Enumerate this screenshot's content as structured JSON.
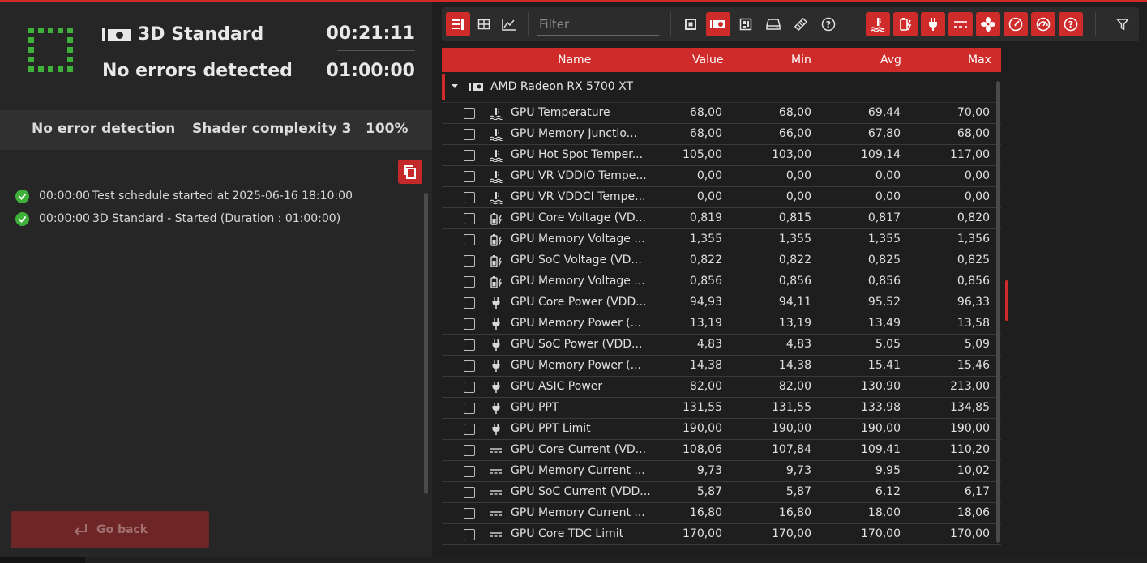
{
  "status": {
    "test_name": "3D Standard",
    "result": "No errors detected",
    "elapsed": "00:21:11",
    "duration": "01:00:00"
  },
  "params": {
    "error_detection": "No error detection",
    "shader": "Shader complexity 3",
    "load": "100%"
  },
  "log": [
    {
      "time": "00:00:00",
      "text": "Test schedule started at 2025-06-16 18:10:00"
    },
    {
      "time": "00:00:00",
      "text": "3D Standard - Started (Duration : 01:00:00)"
    }
  ],
  "go_back_label": "Go back",
  "toolbar": {
    "filter_placeholder": "Filter"
  },
  "columns": {
    "name": "Name",
    "value": "Value",
    "min": "Min",
    "avg": "Avg",
    "max": "Max"
  },
  "device": "AMD Radeon RX 5700 XT",
  "sensors": [
    {
      "icon": "temperature",
      "name": "GPU Temperature",
      "value": "68,00",
      "min": "68,00",
      "avg": "69,44",
      "max": "70,00"
    },
    {
      "icon": "temperature",
      "name": "GPU Memory Junctio...",
      "value": "68,00",
      "min": "66,00",
      "avg": "67,80",
      "max": "68,00"
    },
    {
      "icon": "temperature",
      "name": "GPU Hot Spot Temper...",
      "value": "105,00",
      "min": "103,00",
      "avg": "109,14",
      "max": "117,00"
    },
    {
      "icon": "temperature",
      "name": "GPU VR VDDIO Tempe...",
      "value": "0,00",
      "min": "0,00",
      "avg": "0,00",
      "max": "0,00"
    },
    {
      "icon": "temperature",
      "name": "GPU VR VDDCI Tempe...",
      "value": "0,00",
      "min": "0,00",
      "avg": "0,00",
      "max": "0,00"
    },
    {
      "icon": "voltage",
      "name": "GPU Core Voltage (VD...",
      "value": "0,819",
      "min": "0,815",
      "avg": "0,817",
      "max": "0,820"
    },
    {
      "icon": "voltage",
      "name": "GPU Memory Voltage ...",
      "value": "1,355",
      "min": "1,355",
      "avg": "1,355",
      "max": "1,356"
    },
    {
      "icon": "voltage",
      "name": "GPU SoC Voltage (VD...",
      "value": "0,822",
      "min": "0,822",
      "avg": "0,825",
      "max": "0,825"
    },
    {
      "icon": "voltage",
      "name": "GPU Memory Voltage ...",
      "value": "0,856",
      "min": "0,856",
      "avg": "0,856",
      "max": "0,856"
    },
    {
      "icon": "power",
      "name": "GPU Core Power (VDD...",
      "value": "94,93",
      "min": "94,11",
      "avg": "95,52",
      "max": "96,33"
    },
    {
      "icon": "power",
      "name": "GPU Memory Power (...",
      "value": "13,19",
      "min": "13,19",
      "avg": "13,49",
      "max": "13,58"
    },
    {
      "icon": "power",
      "name": "GPU SoC Power (VDD...",
      "value": "4,83",
      "min": "4,83",
      "avg": "5,05",
      "max": "5,09"
    },
    {
      "icon": "power",
      "name": "GPU Memory Power (...",
      "value": "14,38",
      "min": "14,38",
      "avg": "15,41",
      "max": "15,46"
    },
    {
      "icon": "power",
      "name": "GPU ASIC Power",
      "value": "82,00",
      "min": "82,00",
      "avg": "130,90",
      "max": "213,00"
    },
    {
      "icon": "power",
      "name": "GPU PPT",
      "value": "131,55",
      "min": "131,55",
      "avg": "133,98",
      "max": "134,85"
    },
    {
      "icon": "power",
      "name": "GPU PPT Limit",
      "value": "190,00",
      "min": "190,00",
      "avg": "190,00",
      "max": "190,00"
    },
    {
      "icon": "current",
      "name": "GPU Core Current (VD...",
      "value": "108,06",
      "min": "107,84",
      "avg": "109,41",
      "max": "110,20"
    },
    {
      "icon": "current",
      "name": "GPU Memory Current ...",
      "value": "9,73",
      "min": "9,73",
      "avg": "9,95",
      "max": "10,02"
    },
    {
      "icon": "current",
      "name": "GPU SoC Current (VDD...",
      "value": "5,87",
      "min": "5,87",
      "avg": "6,12",
      "max": "6,17"
    },
    {
      "icon": "current",
      "name": "GPU Memory Current ...",
      "value": "16,80",
      "min": "16,80",
      "avg": "18,00",
      "max": "18,06"
    },
    {
      "icon": "current",
      "name": "GPU Core TDC Limit",
      "value": "170,00",
      "min": "170,00",
      "avg": "170,00",
      "max": "170,00"
    }
  ],
  "colors": {
    "accent": "#d02b2b",
    "ok": "#3fb03a",
    "status_green": "#3fb03a"
  }
}
